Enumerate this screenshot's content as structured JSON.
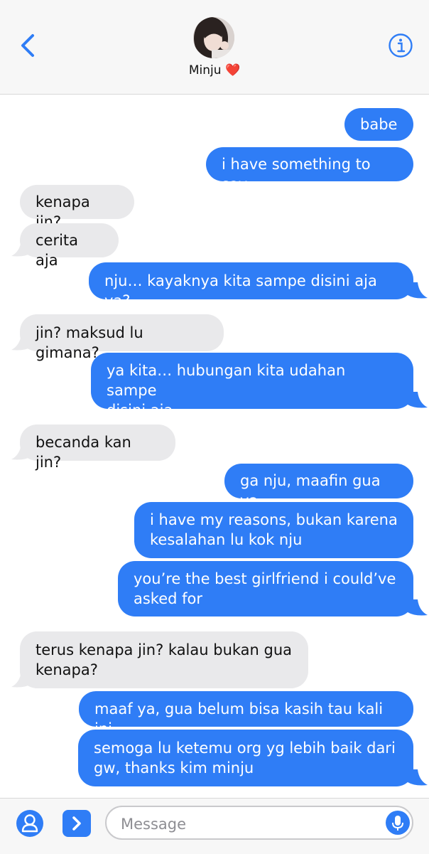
{
  "header": {
    "contact_name": "Minju ❤️",
    "back_icon": "chevron-left-icon",
    "info_icon": "info-icon"
  },
  "messages": [
    {
      "from": "me",
      "text": "babe"
    },
    {
      "from": "me",
      "text": "i have something to say"
    },
    {
      "from": "them",
      "text": "kenapa jin?"
    },
    {
      "from": "them",
      "text": "cerita aja"
    },
    {
      "from": "me",
      "text": "nju… kayaknya kita sampe disini aja ya?"
    },
    {
      "from": "them",
      "text": "jin? maksud lu gimana?"
    },
    {
      "from": "me",
      "lines": [
        "ya kita… hubungan kita udahan sampe",
        "disini aja"
      ]
    },
    {
      "from": "them",
      "text": "becanda kan jin?"
    },
    {
      "from": "me",
      "text": "ga nju, maafin gua ya"
    },
    {
      "from": "me",
      "lines": [
        "i have my reasons, bukan karena",
        "kesalahan lu kok nju"
      ]
    },
    {
      "from": "me",
      "lines": [
        "you’re the best girlfriend i could’ve",
        "asked for"
      ]
    },
    {
      "from": "them",
      "lines": [
        "terus kenapa jin? kalau bukan gua",
        "kenapa?"
      ]
    },
    {
      "from": "me",
      "text": "maaf ya, gua belum bisa kasih tau kali ini"
    },
    {
      "from": "me",
      "lines": [
        "semoga lu ketemu org yg lebih baik dari",
        "gw, thanks kim minju"
      ]
    }
  ],
  "composer": {
    "placeholder": "Message",
    "contact_icon": "contact-icon",
    "apps_icon": "chevron-right-icon",
    "mic_icon": "microphone-icon"
  },
  "colors": {
    "outgoing_bubble": "#2f7df6",
    "incoming_bubble": "#e9e9eb",
    "accent": "#2f7df6"
  }
}
